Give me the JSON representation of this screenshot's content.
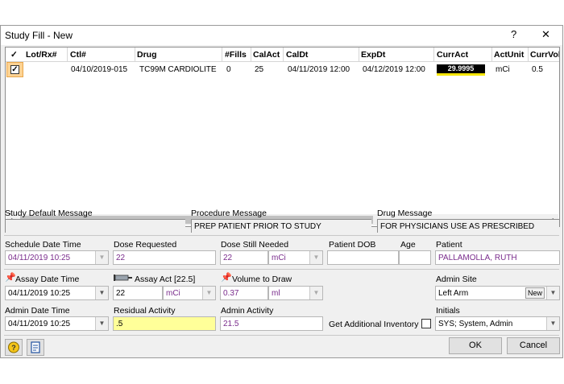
{
  "window": {
    "title": "Study Fill - New",
    "help": "?",
    "close": "✕"
  },
  "grid": {
    "columns": [
      "✓",
      "Lot/Rx#",
      "Ctl#",
      "Drug",
      "#Fills",
      "CalAct",
      "CalDt",
      "ExpDt",
      "CurrAct",
      "ActUnit",
      "CurrVol"
    ],
    "row": {
      "checked": "✓",
      "ctl": "04/10/2019-015",
      "drug": "TC99M CARDIOLITE",
      "fills": "0",
      "calact": "25",
      "caldt": "04/11/2019 12:00",
      "expdt": "04/12/2019 12:00",
      "curract": "29.9995",
      "actunit": "mCi",
      "currvol": "0.5"
    }
  },
  "messages": {
    "study_label": "Study Default Message",
    "study_value": "",
    "procedure_label": "Procedure Message",
    "procedure_value": "PREP PATIENT PRIOR TO STUDY",
    "drug_label": "Drug Message",
    "drug_value": "FOR PHYSICIANS USE AS PRESCRIBED"
  },
  "form": {
    "schedule_label": "Schedule Date Time",
    "schedule_value": "04/11/2019 10:25",
    "dose_req_label": "Dose Requested",
    "dose_req_value": "22",
    "dose_still_label": "Dose Still Needed",
    "dose_still_value": "22",
    "dose_still_unit": "mCi",
    "dob_label": "Patient DOB",
    "dob_value": "",
    "age_label": "Age",
    "age_value": "",
    "patient_label": "Patient",
    "patient_value": "PALLAMOLLA, RUTH",
    "assay_dt_label": "Assay Date Time",
    "assay_dt_value": "04/11/2019 10:25",
    "assay_act_label": "Assay Act [22.5]",
    "assay_act_value": "22",
    "assay_act_unit": "mCi",
    "vol_label": "Volume to Draw",
    "vol_value": "0.37",
    "vol_unit": "ml",
    "admin_site_label": "Admin Site",
    "admin_site_value": "Left Arm",
    "new_label": "New",
    "admin_dt_label": "Admin Date Time",
    "admin_dt_value": "04/11/2019 10:25",
    "residual_label": "Residual Activity",
    "residual_value": ".5",
    "admin_act_label": "Admin Activity",
    "admin_act_value": "21.5",
    "get_inv_label": "Get Additional Inventory",
    "initials_label": "Initials",
    "initials_value": "SYS; System, Admin"
  },
  "buttons": {
    "ok": "OK",
    "cancel": "Cancel"
  }
}
